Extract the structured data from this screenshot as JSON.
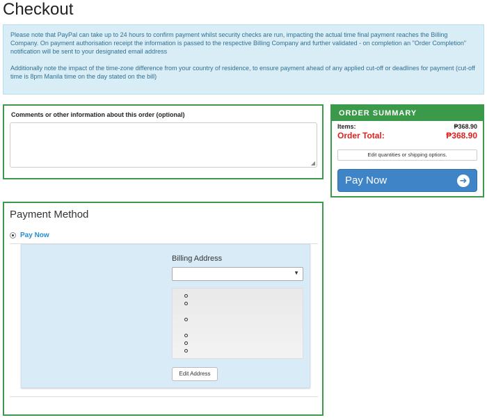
{
  "page": {
    "title": "Checkout"
  },
  "notice": {
    "paragraph1": "Please note that PayPal can take up to 24 hours to confirm payment whilst security checks are run, impacting the actual time final payment reaches the Billing Company.  On payment authorisation receipt the information is passed to the respective Billing Company and further validated - on completion an \"Order Completion\" notification will be sent to your designated email address",
    "paragraph2": "Additionally note the impact of the time-zone difference from your country of residence, to ensure payment ahead of any applied cut-off or deadlines for payment (cut-off time is 8pm Manila time on the day stated on the bill)"
  },
  "comments": {
    "label": "Comments or other information about this order (optional)",
    "value": ""
  },
  "summary": {
    "heading": "ORDER SUMMARY",
    "items_label": "Items:",
    "items_value": "₱368.90",
    "total_label": "Order Total:",
    "total_value": "₱368.90",
    "edit_button": "Edit quantities or shipping options.",
    "pay_button": "Pay Now",
    "pay_icon": "arrow-circle-right-icon",
    "accent_color": "#3b9a4a",
    "total_color": "#e0201d",
    "pay_color": "#3f84c7"
  },
  "payment": {
    "title": "Payment Method",
    "method_label": "Pay Now",
    "billing_label": "Billing Address",
    "billing_selected": "",
    "edit_address_button": "Edit Address"
  }
}
